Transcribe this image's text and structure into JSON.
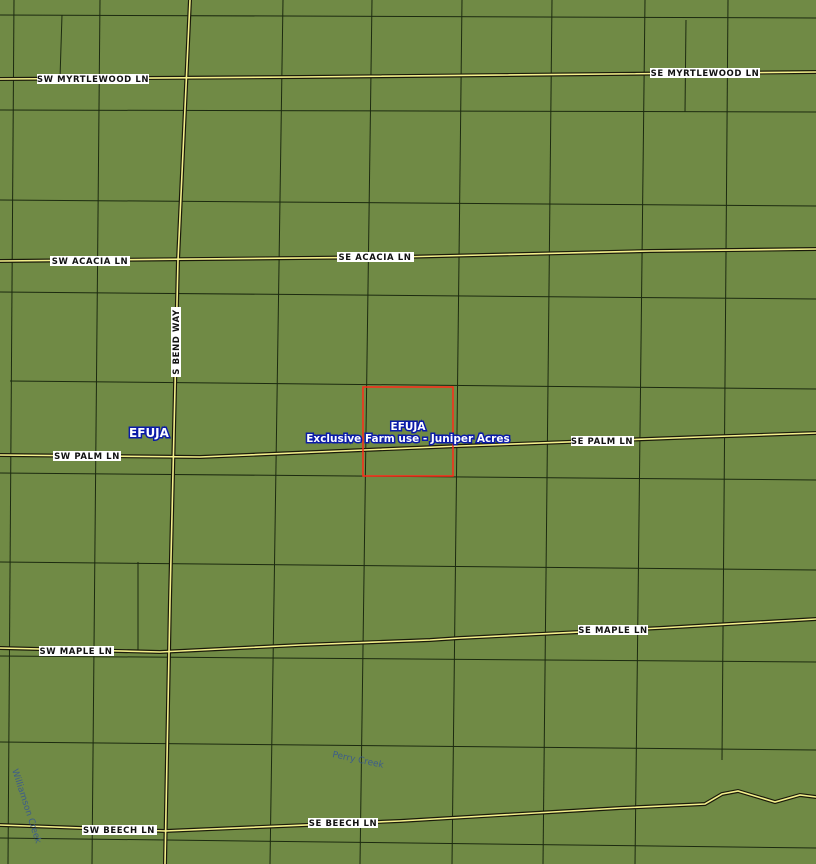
{
  "map": {
    "colors": {
      "land": "#708a45",
      "parcel_line": "#1c2a10",
      "road_casing": "#1a1a0a",
      "road_fill": "#f4f08c",
      "selection": "#ff2a1a",
      "zone_text": "#ffffff",
      "zone_halo": "#0a1aa8",
      "water_text": "#3d5d8a"
    },
    "roads": {
      "sw_myrtlewood": "SW MYRTLEWOOD LN",
      "se_myrtlewood": "SE MYRTLEWOOD LN",
      "sw_acacia": "SW ACACIA LN",
      "se_acacia": "SE ACACIA LN",
      "s_bend": "S BEND WAY",
      "sw_palm": "SW PALM LN",
      "se_palm": "SE PALM LN",
      "sw_maple": "SW MAPLE LN",
      "se_maple": "SE MAPLE LN",
      "sw_beech": "SW BEECH LN",
      "se_beech": "SE BEECH LN"
    },
    "zones": {
      "west_code": "EFUJA",
      "center_code": "EFUJA",
      "center_description": "Exclusive Farm use - Juniper Acres"
    },
    "water": {
      "perry_creek": "Perry Creek",
      "williamson_creek": "Williamson Creek"
    },
    "selected_parcel": "selected-parcel"
  }
}
